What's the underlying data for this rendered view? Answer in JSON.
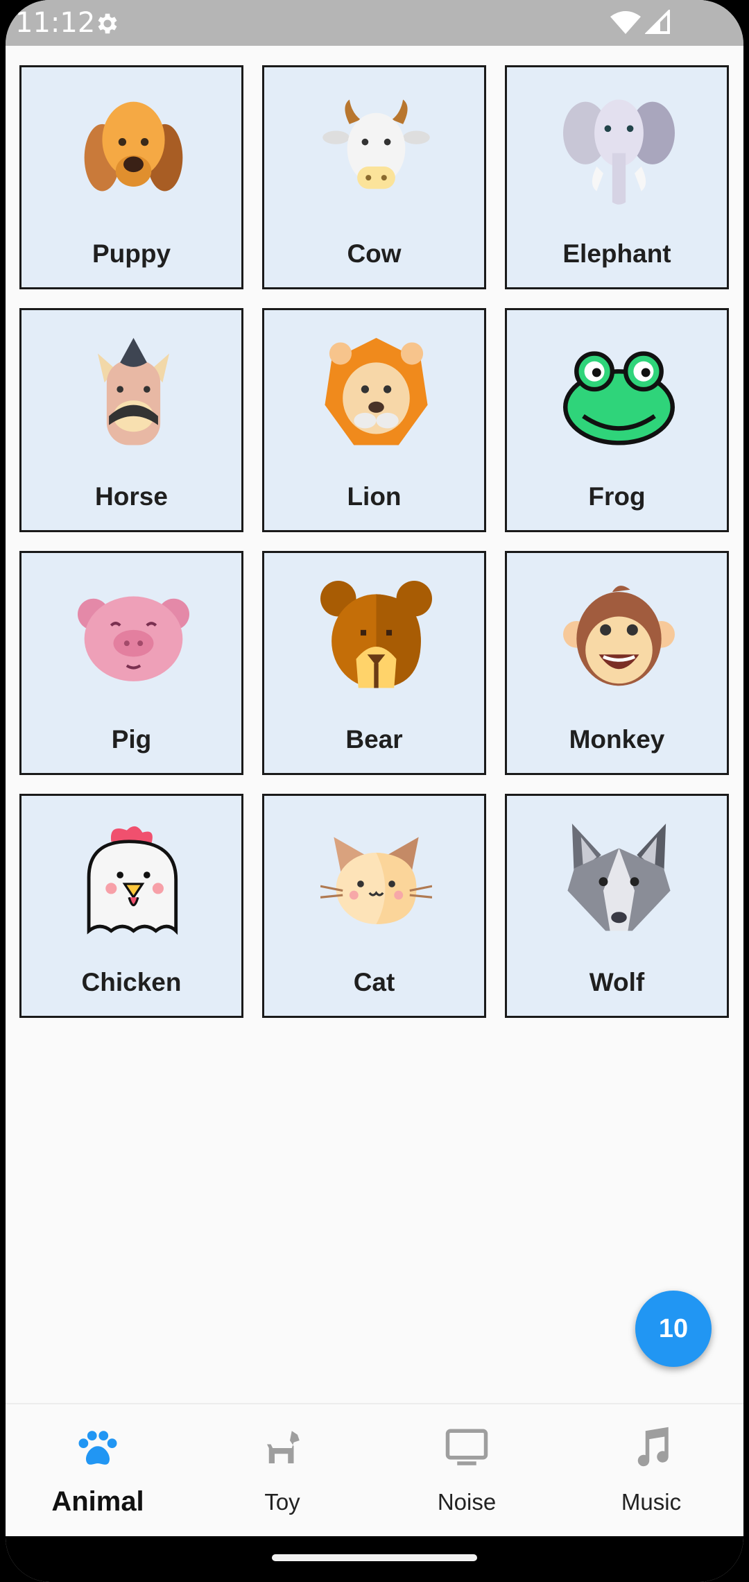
{
  "status_bar": {
    "time": "11:12",
    "icons": [
      "gear-icon",
      "wifi-icon",
      "signal-icon"
    ]
  },
  "animals": [
    {
      "label": "Puppy",
      "icon": "puppy-face-icon"
    },
    {
      "label": "Cow",
      "icon": "cow-face-icon"
    },
    {
      "label": "Elephant",
      "icon": "elephant-face-icon"
    },
    {
      "label": "Horse",
      "icon": "horse-face-icon"
    },
    {
      "label": "Lion",
      "icon": "lion-face-icon"
    },
    {
      "label": "Frog",
      "icon": "frog-face-icon"
    },
    {
      "label": "Pig",
      "icon": "pig-face-icon"
    },
    {
      "label": "Bear",
      "icon": "bear-face-icon"
    },
    {
      "label": "Monkey",
      "icon": "monkey-face-icon"
    },
    {
      "label": "Chicken",
      "icon": "chicken-face-icon"
    },
    {
      "label": "Cat",
      "icon": "cat-face-icon"
    },
    {
      "label": "Wolf",
      "icon": "wolf-face-icon"
    }
  ],
  "fab": {
    "count": "10"
  },
  "bottom_nav": {
    "items": [
      {
        "label": "Animal",
        "icon": "paw-icon",
        "active": true
      },
      {
        "label": "Toy",
        "icon": "toy-dog-icon",
        "active": false
      },
      {
        "label": "Noise",
        "icon": "monitor-icon",
        "active": false
      },
      {
        "label": "Music",
        "icon": "music-note-icon",
        "active": false
      }
    ]
  },
  "colors": {
    "accent": "#2196f3",
    "tile_background": "#e3edf8",
    "tile_border": "#1a1a1a",
    "inactive_icon": "#9e9e9e",
    "status_bar": "#b5b5b5"
  }
}
